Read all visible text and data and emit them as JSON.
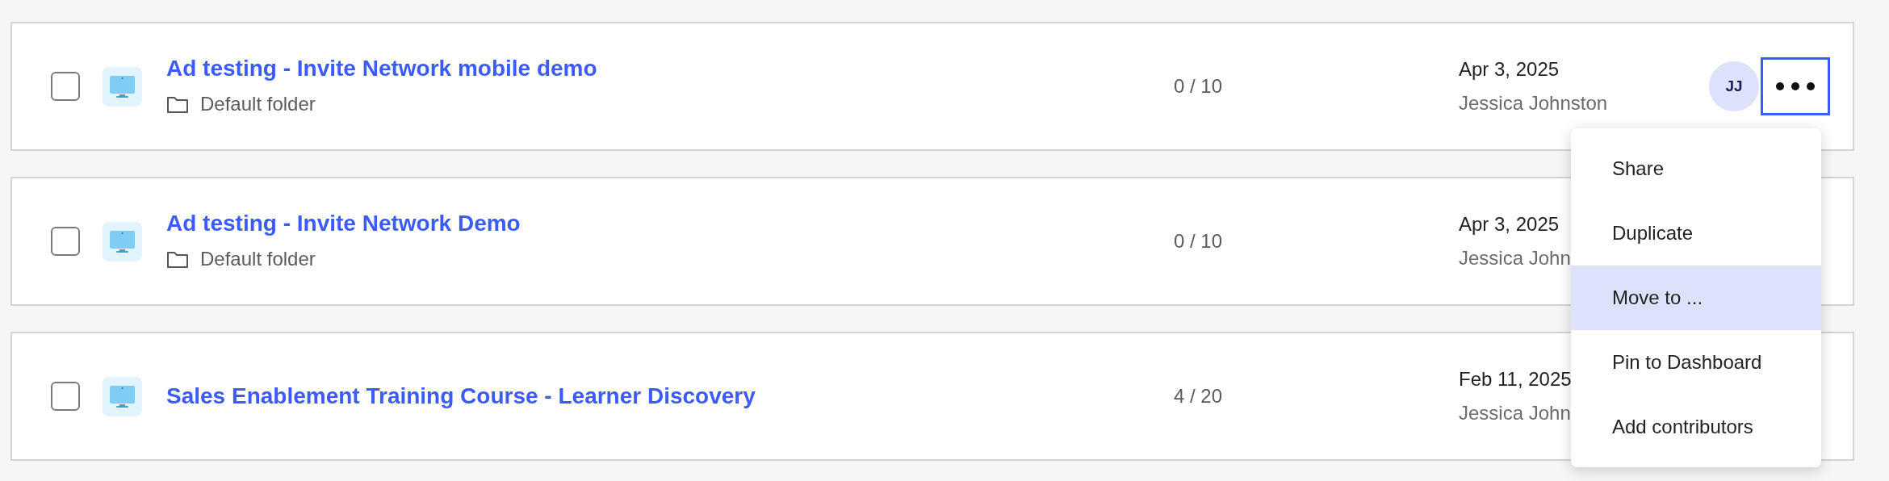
{
  "rows": [
    {
      "checked": false,
      "title": "Ad testing - Invite Network mobile demo",
      "folder": "Default folder",
      "count": "0 / 10",
      "date": "Apr 3, 2025",
      "author": "Jessica Johnston",
      "avatar": "JJ"
    },
    {
      "checked": false,
      "title": "Ad testing - Invite Network Demo",
      "folder": "Default folder",
      "count": "0 / 10",
      "date": "Apr 3, 2025",
      "author": "Jessica John"
    },
    {
      "checked": false,
      "title": "Sales Enablement Training Course - Learner Discovery",
      "count": "4 / 20",
      "date": "Feb 11, 2025",
      "author": "Jessica John"
    }
  ],
  "menu": {
    "open": true,
    "items": [
      {
        "label": "Share",
        "selected": false
      },
      {
        "label": "Duplicate",
        "selected": false
      },
      {
        "label": "Move to ...",
        "selected": true
      },
      {
        "label": "Pin to Dashboard",
        "selected": false
      },
      {
        "label": "Add contributors",
        "selected": false
      }
    ]
  }
}
